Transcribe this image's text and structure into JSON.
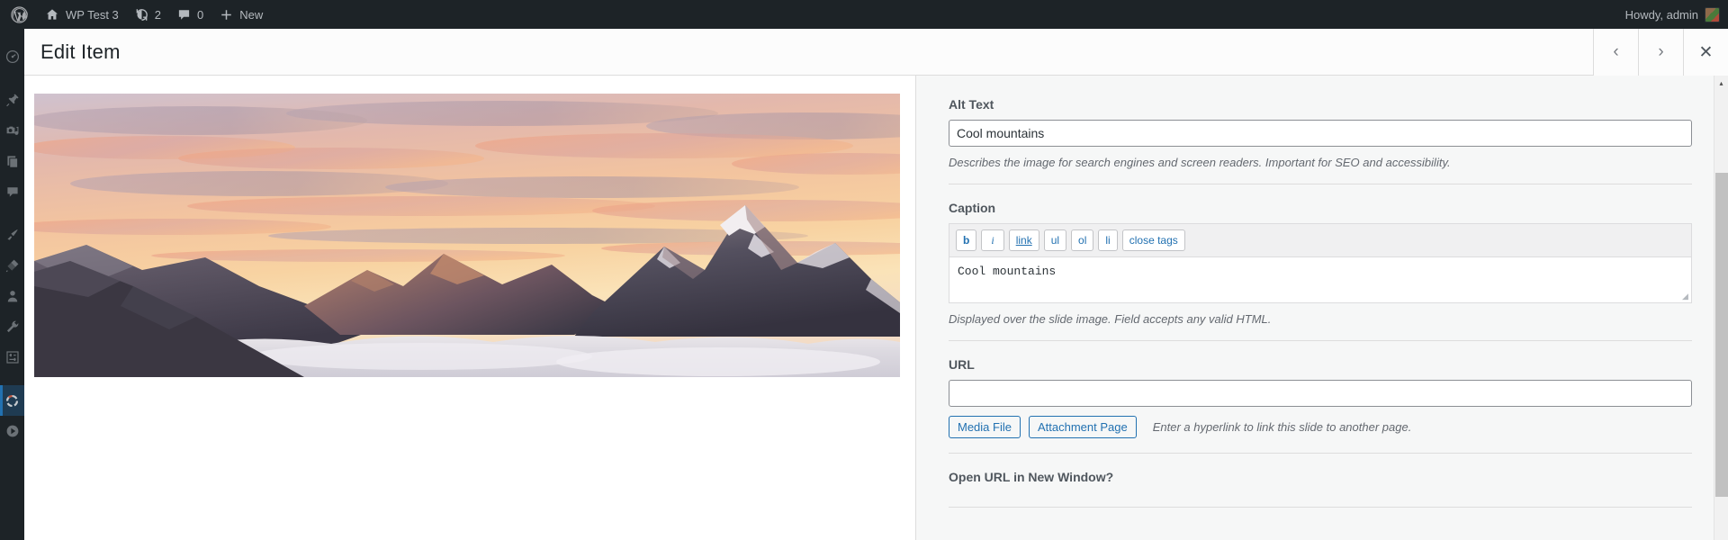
{
  "adminbar": {
    "logo_icon": "wordpress-logo-icon",
    "site_icon": "home-icon",
    "site_name": "WP Test 3",
    "updates_icon": "updates-icon",
    "updates_count": "2",
    "comments_icon": "comment-bubble-icon",
    "comments_count": "0",
    "new_icon": "plus-icon",
    "new_label": "New",
    "howdy": "Howdy, admin",
    "avatar": "user-avatar"
  },
  "sidebar": {
    "items": [
      {
        "name": "dashboard",
        "icon": "dashboard-gauge-icon",
        "current": false
      },
      {
        "name": "posts",
        "icon": "pushpin-icon",
        "current": false
      },
      {
        "name": "media",
        "icon": "camera-media-icon",
        "current": false
      },
      {
        "name": "pages",
        "icon": "pages-icon",
        "current": false
      },
      {
        "name": "comments",
        "icon": "comment-bubble-icon",
        "current": false
      },
      {
        "name": "appearance",
        "icon": "paintbrush-icon",
        "current": false
      },
      {
        "name": "plugins",
        "icon": "plug-icon",
        "current": false
      },
      {
        "name": "users",
        "icon": "user-icon",
        "current": false
      },
      {
        "name": "tools",
        "icon": "wrench-icon",
        "current": false
      },
      {
        "name": "settings",
        "icon": "settings-sliders-icon",
        "current": false
      },
      {
        "name": "slider",
        "icon": "slider-ring-icon",
        "current": true
      },
      {
        "name": "media-player",
        "icon": "play-circle-icon",
        "current": false
      }
    ]
  },
  "modal": {
    "title": "Edit Item",
    "prev_icon": "chevron-left-icon",
    "prev_label": "‹",
    "next_icon": "chevron-right-icon",
    "next_label": "›",
    "close_icon": "close-x-icon",
    "close_label": "✕"
  },
  "media": {
    "alt": "Cool mountains",
    "description": "Sunset over snow-capped mountain peaks above a sea of clouds"
  },
  "form": {
    "alt_text": {
      "label": "Alt Text",
      "value": "Cool mountains",
      "help": "Describes the image for search engines and screen readers. Important for SEO and accessibility."
    },
    "caption": {
      "label": "Caption",
      "value": "Cool mountains",
      "help": "Displayed over the slide image. Field accepts any valid HTML.",
      "quicktags": [
        {
          "name": "bold",
          "label": "b"
        },
        {
          "name": "italic",
          "label": "i"
        },
        {
          "name": "link",
          "label": "link"
        },
        {
          "name": "unordered-list",
          "label": "ul"
        },
        {
          "name": "ordered-list",
          "label": "ol"
        },
        {
          "name": "list-item",
          "label": "li"
        },
        {
          "name": "close-tags",
          "label": "close tags"
        }
      ]
    },
    "url": {
      "label": "URL",
      "value": "",
      "media_file_label": "Media File",
      "attachment_page_label": "Attachment Page",
      "help": "Enter a hyperlink to link this slide to another page."
    },
    "new_window": {
      "label": "Open URL in New Window?"
    }
  },
  "scrollbar": {
    "up_arrow": "▴"
  },
  "colors": {
    "admin_bg": "#1d2327",
    "accent": "#2271b1",
    "current_item_bg": "#1f3b52",
    "panel_bg": "#f6f7f7"
  }
}
